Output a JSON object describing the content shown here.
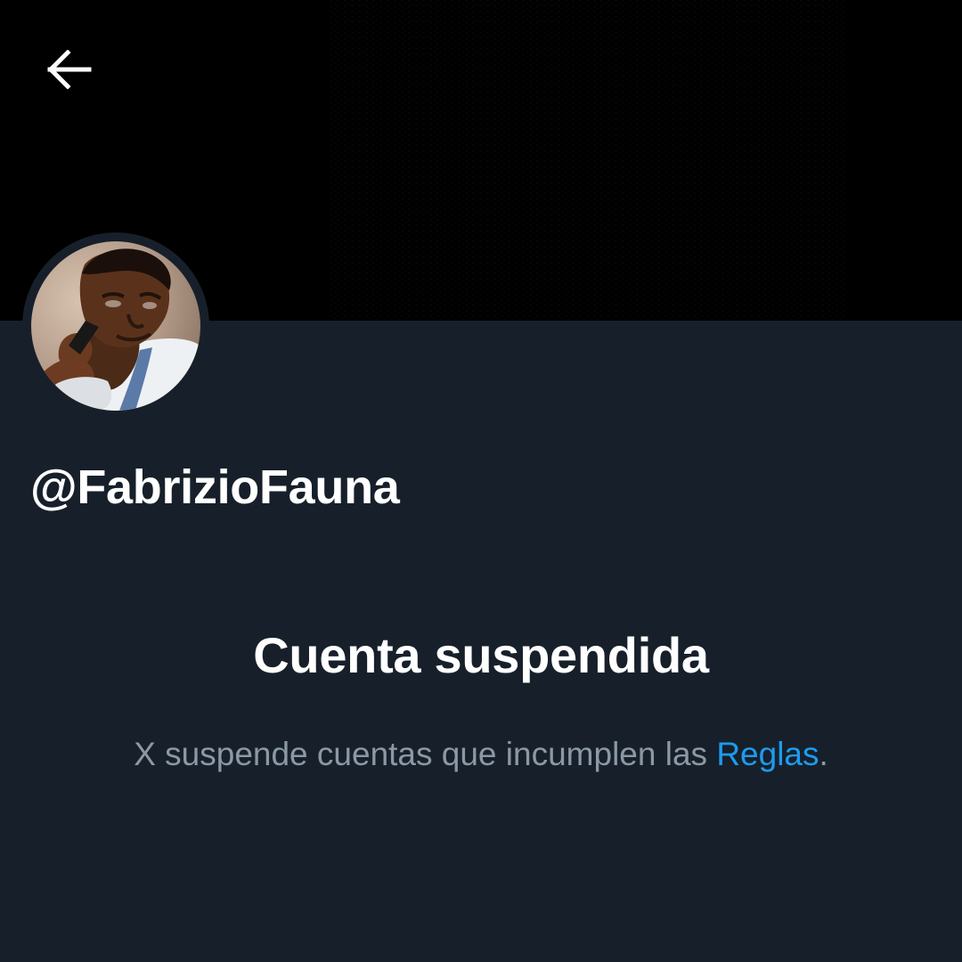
{
  "header": {
    "back_icon": "arrow-left-icon"
  },
  "banner": {
    "background_color": "#000000"
  },
  "profile": {
    "avatar_icon": "profile-photo",
    "handle": "@FabrizioFauna"
  },
  "suspension": {
    "title": "Cuenta suspendida",
    "message_prefix": "X suspende cuentas que incumplen las ",
    "rules_link": "Reglas",
    "message_suffix": "."
  },
  "colors": {
    "page_background": "#17202a",
    "primary_text": "#ffffff",
    "secondary_text": "#8b98a5",
    "link": "#1d9bf0"
  }
}
